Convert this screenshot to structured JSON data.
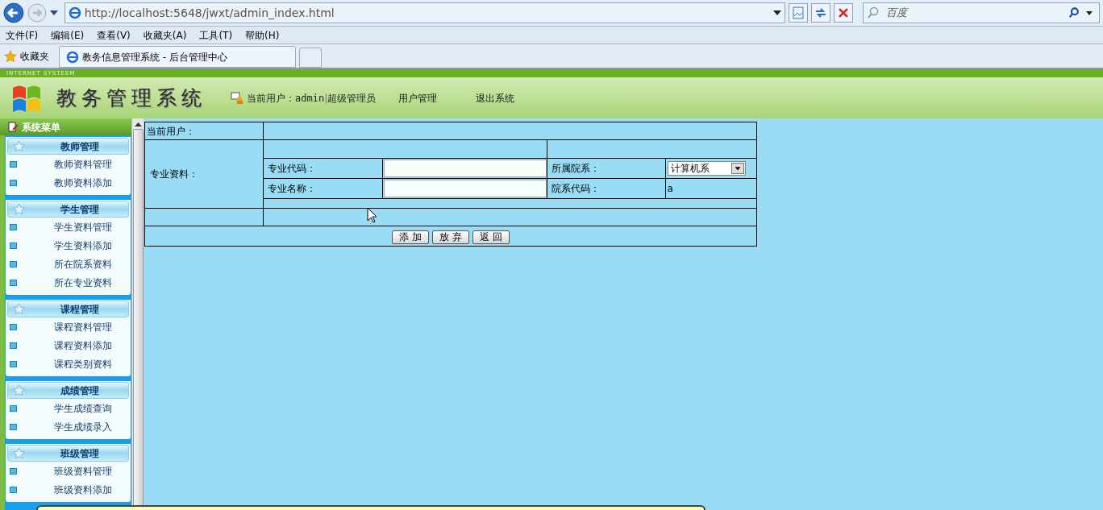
{
  "browser": {
    "address": "http://localhost:5648/jwxt/admin_index.html",
    "search_placeholder": "百度",
    "menu": [
      "文件(F)",
      "编辑(E)",
      "查看(V)",
      "收藏夹(A)",
      "工具(T)",
      "帮助(H)"
    ],
    "favorites": "收藏夹",
    "tab_title": "教务信息管理系统 - 后台管理中心"
  },
  "header": {
    "strip_text": "INTERNET SYSTEEM",
    "title": "教务管理系统",
    "user_label": "当前用户：",
    "user_name": "admin",
    "separator": "|",
    "user_role": "超级管理员",
    "nav": [
      "用户管理",
      "退出系统"
    ]
  },
  "sidebar": {
    "title": "系统菜单",
    "groups": [
      {
        "title": "教师管理",
        "items": [
          "教师资料管理",
          "教师资料添加"
        ]
      },
      {
        "title": "学生管理",
        "items": [
          "学生资料管理",
          "学生资料添加",
          "所在院系资料",
          "所在专业资料"
        ]
      },
      {
        "title": "课程管理",
        "items": [
          "课程资料管理",
          "课程资料添加",
          "课程类别资料"
        ]
      },
      {
        "title": "成绩管理",
        "items": [
          "学生成绩查询",
          "学生成绩录入"
        ]
      },
      {
        "title": "班级管理",
        "items": [
          "班级资料管理",
          "班级资料添加"
        ]
      }
    ]
  },
  "form": {
    "current_user_label": "当前用户：",
    "section_label": "专业资料：",
    "rows": [
      [
        {
          "label": "专业代码：",
          "kind": "input"
        },
        {
          "label": "所属院系：",
          "kind": "select",
          "value": "计算机系"
        }
      ],
      [
        {
          "label": "专业名称：",
          "kind": "input"
        },
        {
          "label": "院系代码：",
          "kind": "text",
          "value": "a"
        }
      ]
    ],
    "buttons": [
      "添 加",
      "放 弃",
      "返 回"
    ]
  }
}
